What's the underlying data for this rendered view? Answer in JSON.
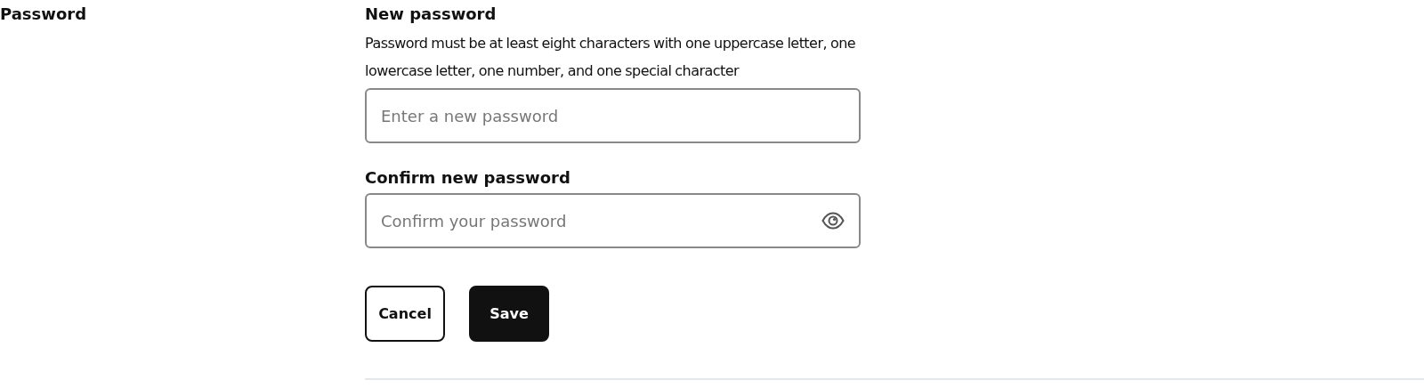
{
  "section": {
    "title": "Password"
  },
  "fields": [
    {
      "label": "New password",
      "hint": "Password must be at least eight characters with one uppercase letter, one lowercase letter, one number, and one special character",
      "placeholder": "Enter a new password",
      "reveal_toggle": false
    },
    {
      "label": "Confirm new password",
      "placeholder": "Confirm your password",
      "reveal_toggle": true
    }
  ],
  "buttons": [
    {
      "label": "Cancel",
      "kind": "secondary"
    },
    {
      "label": "Save",
      "kind": "primary"
    }
  ]
}
